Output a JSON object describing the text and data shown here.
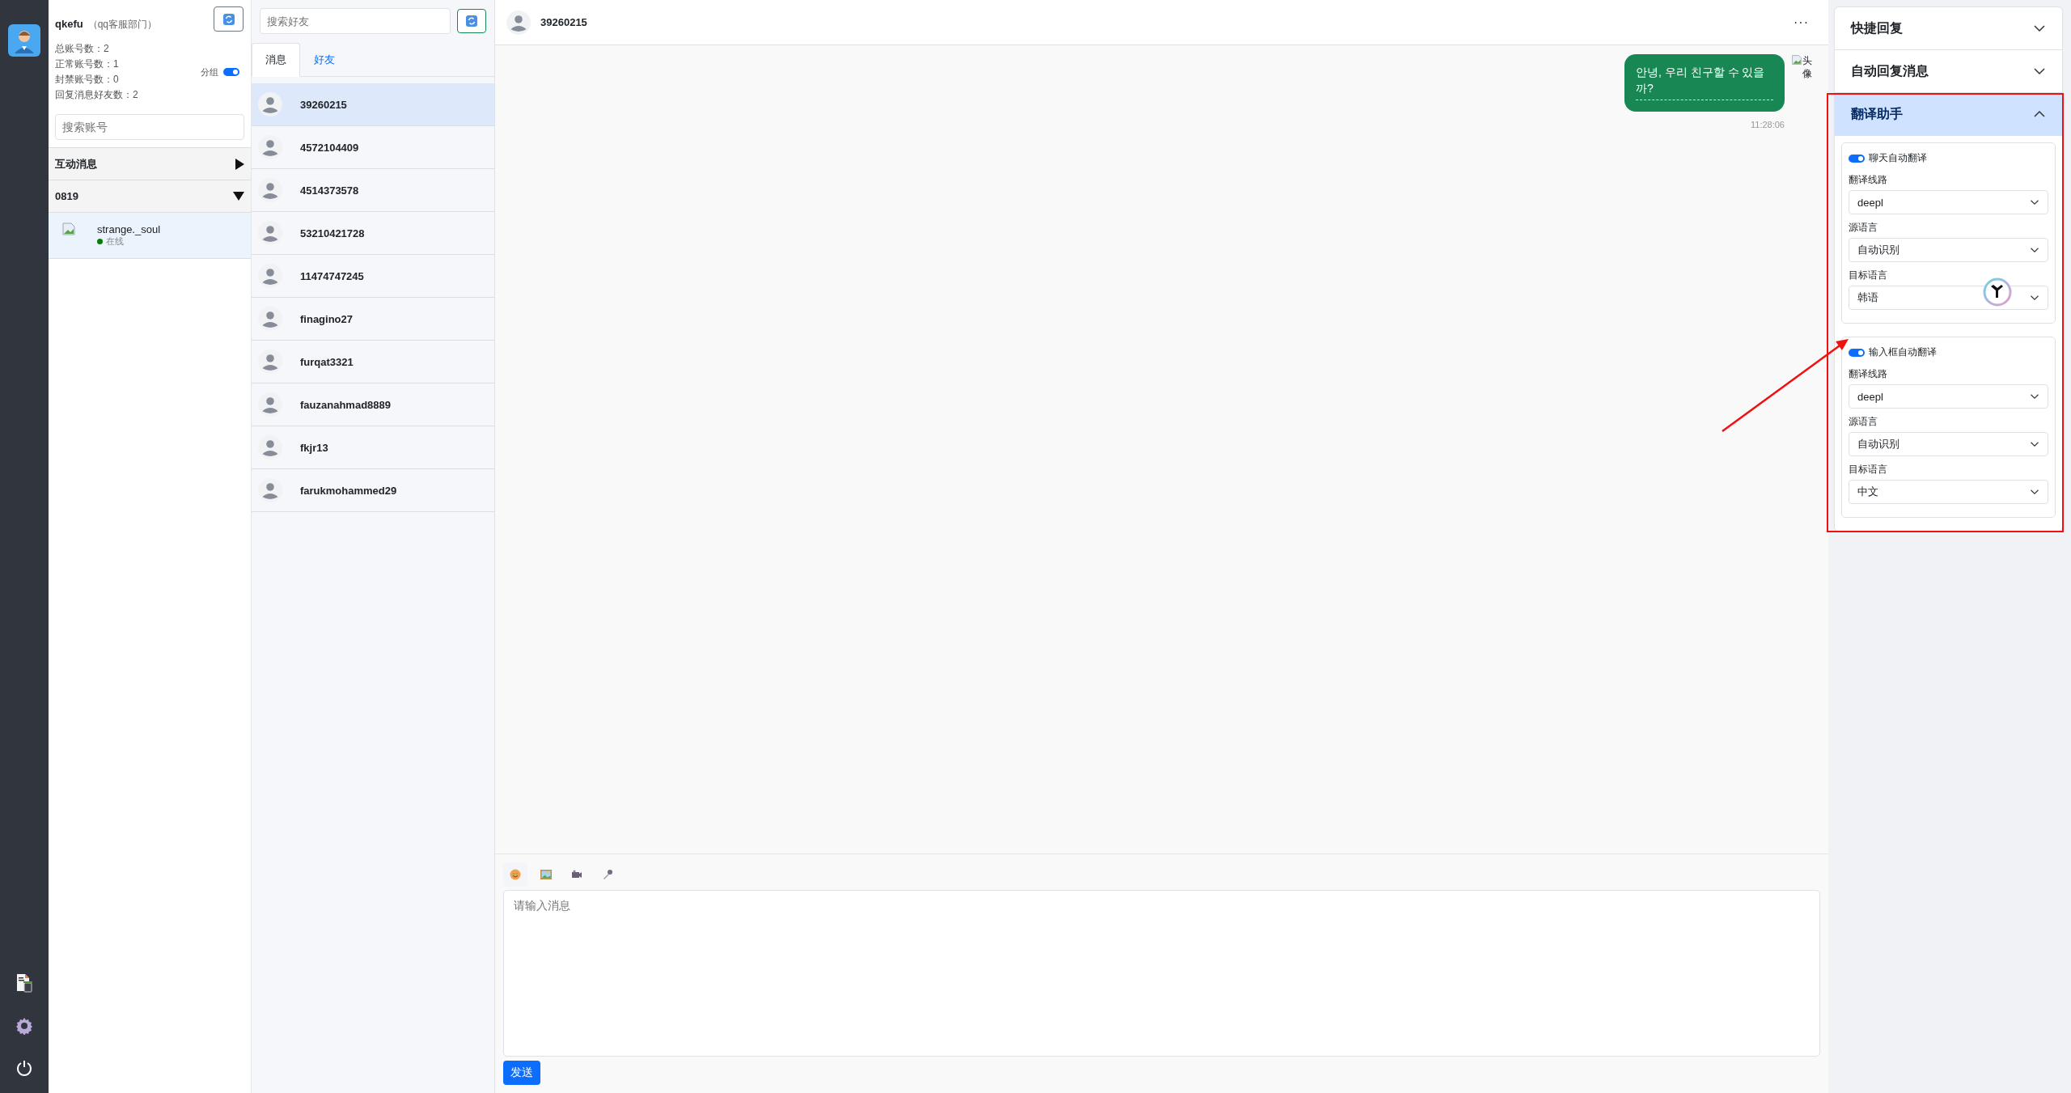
{
  "account": {
    "name": "qkefu",
    "department": "（qq客服部门）",
    "stats": [
      "总账号数：2",
      "正常账号数：1",
      "封禁账号数：0",
      "回复消息好友数：2"
    ],
    "group_toggle": {
      "label": "分组",
      "on": true
    },
    "search": {
      "placeholder": "搜索账号"
    },
    "groups": [
      {
        "title": "互动消息",
        "expanded": false
      },
      {
        "title": "0819",
        "expanded": true,
        "members": [
          {
            "name": "strange._soul",
            "status": "在线",
            "online": true,
            "selected": true
          }
        ]
      }
    ]
  },
  "friends": {
    "search": {
      "placeholder": "搜索好友"
    },
    "tabs": [
      {
        "label": "消息",
        "selected": true
      },
      {
        "label": "好友",
        "selected": false
      }
    ],
    "items": [
      {
        "name": "39260215",
        "selected": true
      },
      {
        "name": "4572104409",
        "selected": false
      },
      {
        "name": "4514373578",
        "selected": false
      },
      {
        "name": "53210421728",
        "selected": false
      },
      {
        "name": "11474747245",
        "selected": false
      },
      {
        "name": "finagino27",
        "selected": false
      },
      {
        "name": "furqat3321",
        "selected": false
      },
      {
        "name": "fauzanahmad8889",
        "selected": false
      },
      {
        "name": "fkjr13",
        "selected": false
      },
      {
        "name": "farukmohammed29",
        "selected": false
      }
    ]
  },
  "chat": {
    "title": "39260215",
    "menu": "···",
    "messages": [
      {
        "text": "안녕, 우리 친구할 수 있을까?",
        "time": "11:28:06",
        "avatar_alt": "头像",
        "outgoing": true
      }
    ],
    "input": {
      "placeholder": "请输入消息"
    },
    "send": "发送"
  },
  "right_panel": {
    "accordion": [
      {
        "title": "快捷回复",
        "expanded": false
      },
      {
        "title": "自动回复消息",
        "expanded": false
      },
      {
        "title": "翻译助手",
        "expanded": true,
        "highlighted": true,
        "sections": [
          {
            "toggle": {
              "label": "聊天自动翻译",
              "on": true
            },
            "fields": [
              {
                "label": "翻译线路",
                "value": "deepl"
              },
              {
                "label": "源语言",
                "value": "自动识别"
              },
              {
                "label": "目标语言",
                "value": "韩语"
              }
            ]
          },
          {
            "toggle": {
              "label": "输入框自动翻译",
              "on": true
            },
            "pointed_at": true,
            "fields": [
              {
                "label": "翻译线路",
                "value": "deepl"
              },
              {
                "label": "源语言",
                "value": "自动识别"
              },
              {
                "label": "目标语言",
                "value": "中文"
              }
            ]
          }
        ]
      }
    ]
  }
}
